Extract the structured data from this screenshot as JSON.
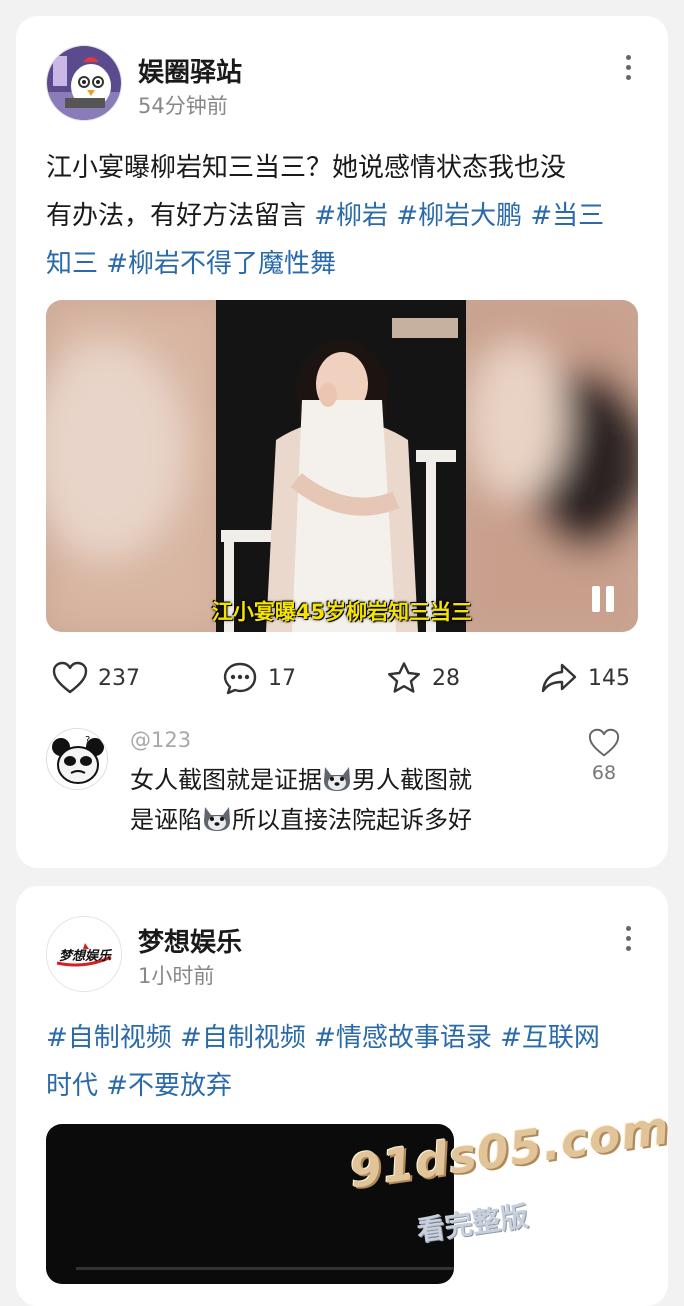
{
  "post1": {
    "author": "娱圈驿站",
    "time": "54分钟前",
    "text_lines": [
      {
        "plain": "江小宴曝柳岩知三当三？她说感情状态我也没",
        "tags": ""
      },
      {
        "plain": "有办法，有好方法留言 ",
        "tags": "#柳岩 #柳岩大鹏 #当三"
      },
      {
        "plain": "",
        "tags": "知三 #柳岩不得了魔性舞"
      }
    ],
    "video_caption": "江小宴曝45岁柳岩知三当三",
    "likes": "237",
    "comments": "17",
    "stars": "28",
    "shares": "145",
    "top_comment": {
      "user": "@123",
      "line1_a": "女人截图就是证据",
      "line1_b": "男人截图就",
      "line2_a": "是诬陷",
      "line2_b": "所以直接法院起诉多好",
      "likes": "68"
    }
  },
  "post2": {
    "author": "梦想娱乐",
    "time": "1小时前",
    "logo_text": "梦想娱乐",
    "tag_line1": "#自制视频 #自制视频 #情感故事语录 #互联网",
    "tag_line2": "时代 #不要放弃"
  },
  "watermark": {
    "domain": "91ds05.com",
    "sub": "看完整版"
  },
  "colors": {
    "tag": "#2a6aaa",
    "caption": "#f5e400",
    "background": "#f2f2f2"
  }
}
